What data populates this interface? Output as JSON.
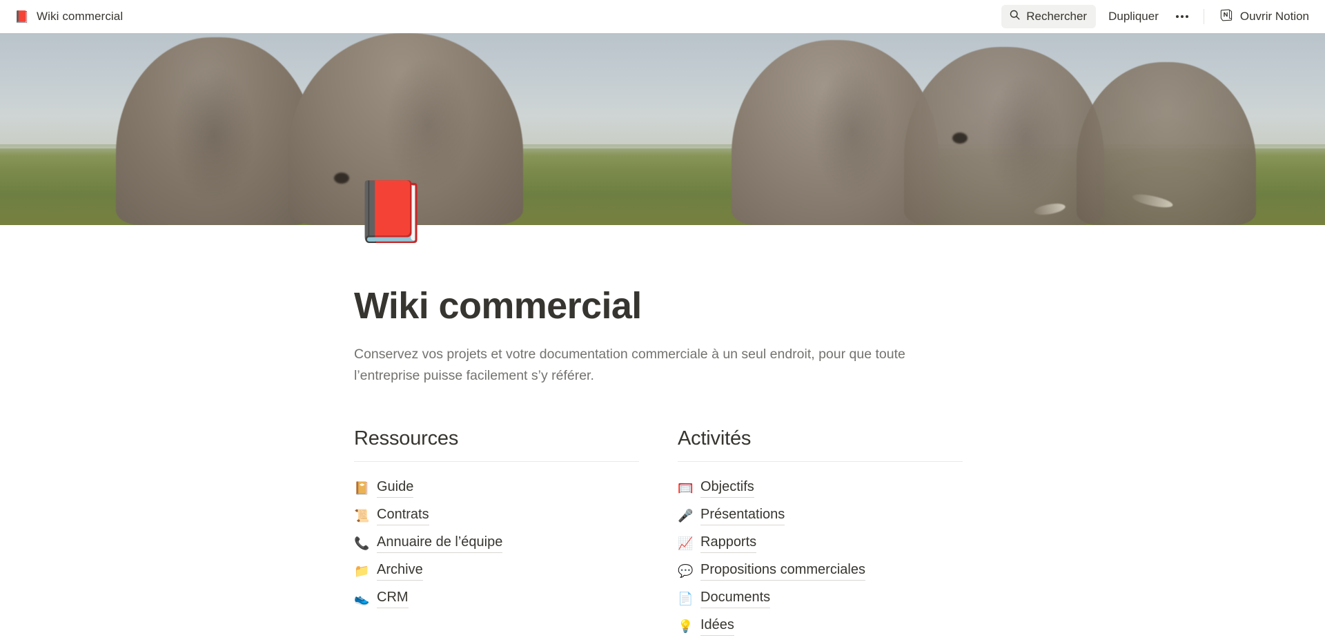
{
  "topbar": {
    "page_icon": "📕",
    "page_icon_name": "closed-book-emoji",
    "page_title": "Wiki commercial",
    "search_label": "Rechercher",
    "duplicate_label": "Dupliquer",
    "more_label": "•••",
    "open_notion_label": "Ouvrir Notion"
  },
  "cover": {
    "description": "Photo de couverture : trois éléphants dans la savane",
    "sky_color": "#c4cdd2",
    "grass_color": "#7c8b4c",
    "elephant_color": "#8a7e70"
  },
  "page": {
    "icon": "📕",
    "title": "Wiki commercial",
    "description": "Conservez vos projets et votre documentation commerciale à un seul endroit, pour que toute l’entreprise puisse facilement s’y référer."
  },
  "columns": [
    {
      "heading": "Ressources",
      "links": [
        {
          "emoji": "📔",
          "icon_name": "notebook-icon",
          "label": "Guide"
        },
        {
          "emoji": "📜",
          "icon_name": "scroll-icon",
          "label": "Contrats"
        },
        {
          "emoji": "📞",
          "icon_name": "telephone-receiver-icon",
          "label": "Annuaire de l’équipe"
        },
        {
          "emoji": "📁",
          "icon_name": "folder-icon",
          "label": "Archive"
        },
        {
          "emoji": "👟",
          "icon_name": "running-shoe-icon",
          "label": "CRM"
        }
      ]
    },
    {
      "heading": "Activités",
      "links": [
        {
          "emoji": "🥅",
          "icon_name": "goal-net-icon",
          "label": "Objectifs"
        },
        {
          "emoji": "🎤",
          "icon_name": "microphone-icon",
          "label": "Présentations"
        },
        {
          "emoji": "📈",
          "icon_name": "chart-increasing-icon",
          "label": "Rapports"
        },
        {
          "emoji": "💬",
          "icon_name": "speech-balloon-icon",
          "label": "Propositions commerciales"
        },
        {
          "emoji": "📄",
          "icon_name": "document-page-icon",
          "label": "Documents"
        },
        {
          "emoji": "💡",
          "icon_name": "light-bulb-icon",
          "label": "Idées"
        }
      ]
    }
  ],
  "colors": {
    "text": "#37352f",
    "muted": "#73726e",
    "rule": "#e9e9e7",
    "pill_bg": "#f1f1ef"
  }
}
